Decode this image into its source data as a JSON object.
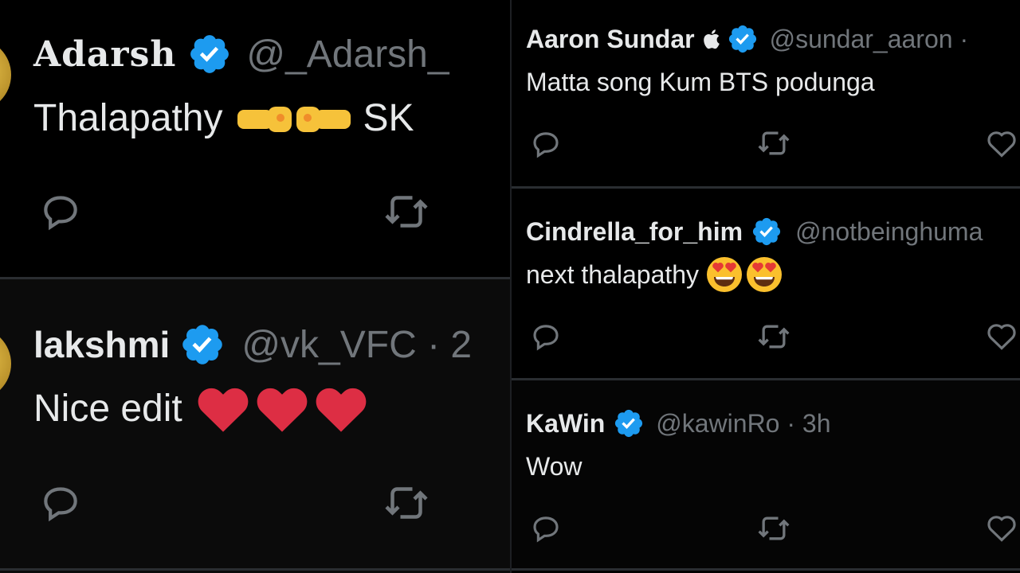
{
  "colors": {
    "background": "#000000",
    "text": "#e7e9ea",
    "secondary": "#71767b",
    "verified": "#1d9bf0",
    "heart": "#e0245e"
  },
  "left_tweets": [
    {
      "name": "Adarsh",
      "handle": "@_Adarsh_",
      "text": "Thalapathy",
      "text_suffix": "SK",
      "emojis": [
        "fist-bump-icon",
        "fist-bump-icon"
      ]
    },
    {
      "name": "lakshmi",
      "handle": "@vk_VFC · 2",
      "text": "Nice edit",
      "emojis": [
        "red-heart-icon",
        "red-heart-icon",
        "red-heart-icon"
      ]
    }
  ],
  "right_tweets": [
    {
      "name": "Aaron Sundar",
      "name_icon": "apple-icon",
      "handle": "@sundar_aaron ·",
      "text": "Matta song Kum BTS podunga"
    },
    {
      "name": "Cindrella_for_him",
      "handle": "@notbeinghuma",
      "text": "next thalapathy",
      "emojis": [
        "heart-eyes-icon",
        "heart-eyes-icon"
      ]
    },
    {
      "name": "KaWin",
      "handle": "@kawinRo · 3h",
      "text": "Wow"
    }
  ]
}
